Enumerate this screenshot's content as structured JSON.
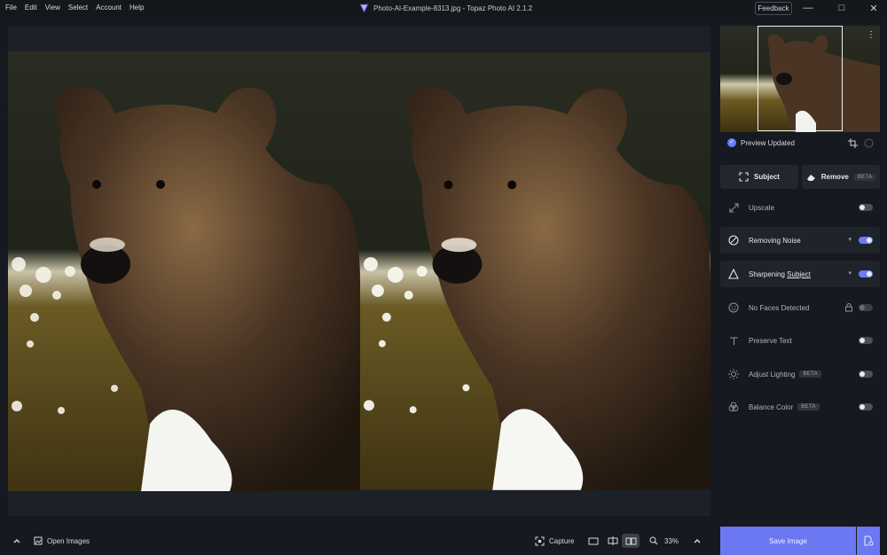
{
  "menu": [
    "File",
    "Edit",
    "View",
    "Select",
    "Account",
    "Help"
  ],
  "window_title": "Photo-AI-Example-8313.jpg - Topaz Photo AI 2.1.2",
  "feedback_label": "Feedback",
  "preview": {
    "status": "Preview Updated"
  },
  "actions": {
    "subject_label": "Subject",
    "remove_label": "Remove",
    "remove_badge": "BETA"
  },
  "filters": [
    {
      "label": "Upscale",
      "state": "off"
    },
    {
      "label": "Removing Noise",
      "state": "on"
    },
    {
      "label_prefix": "Sharpening ",
      "label_link": "Subject",
      "state": "on"
    },
    {
      "label": "No Faces Detected",
      "state": "disabled"
    },
    {
      "label": "Preserve Text",
      "state": "off"
    },
    {
      "label": "Adjust Lighting",
      "badge": "BETA",
      "state": "off"
    },
    {
      "label": "Balance Color",
      "badge": "BETA",
      "state": "off"
    }
  ],
  "bottom": {
    "open_images_label": "Open Images",
    "capture_label": "Capture",
    "zoom": "33%"
  },
  "save_label": "Save Image",
  "colors": {
    "accent": "#6b78f2",
    "background": "#161a20",
    "canvas": "#1c2027"
  }
}
